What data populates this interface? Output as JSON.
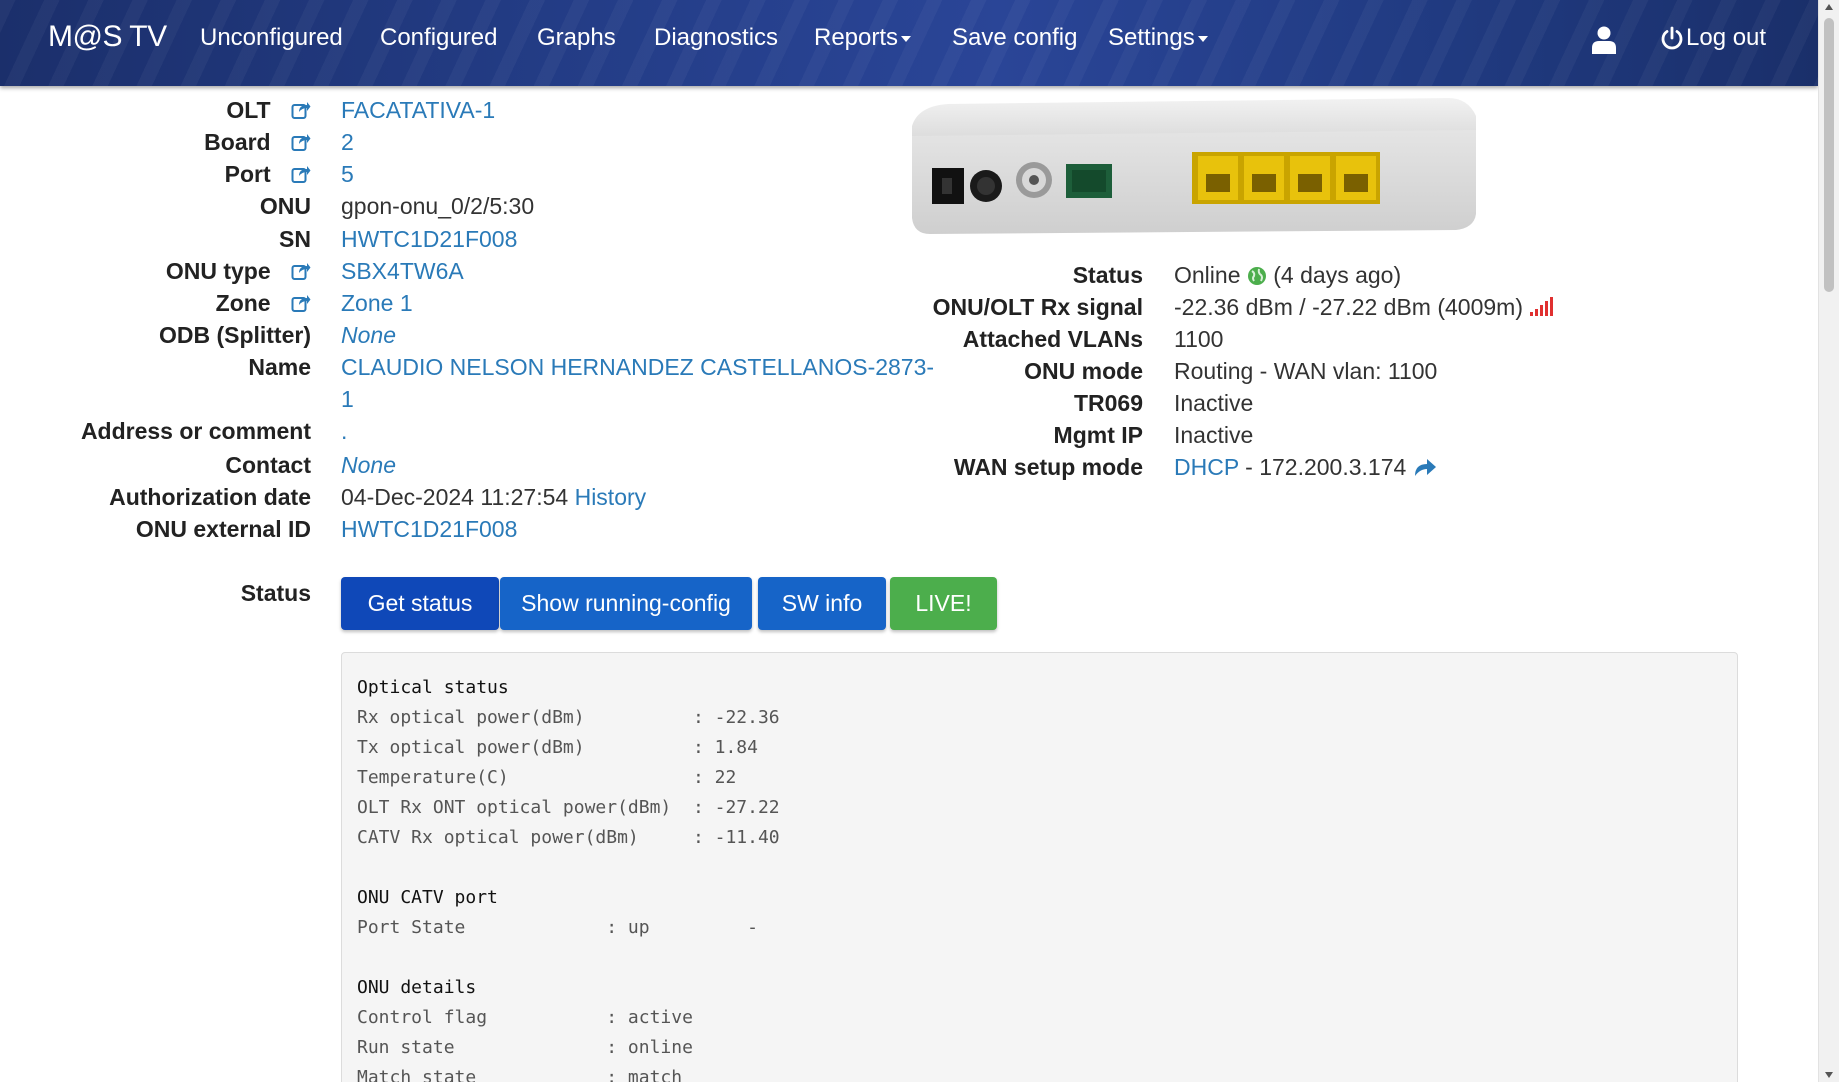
{
  "navbar": {
    "brand": "M@S TV",
    "items": [
      {
        "label": "Unconfigured"
      },
      {
        "label": "Configured"
      },
      {
        "label": "Graphs"
      },
      {
        "label": "Diagnostics"
      },
      {
        "label": "Reports"
      },
      {
        "label": "Save config"
      },
      {
        "label": "Settings"
      }
    ],
    "user_icon": "user-icon",
    "logout_label": "Log out"
  },
  "onu_details": {
    "olt": {
      "label": "OLT",
      "value": "FACATATIVA-1"
    },
    "board": {
      "label": "Board",
      "value": "2"
    },
    "port": {
      "label": "Port",
      "value": "5"
    },
    "onu": {
      "label": "ONU",
      "value": "gpon-onu_0/2/5:30"
    },
    "sn": {
      "label": "SN",
      "value": "HWTC1D21F008"
    },
    "onu_type": {
      "label": "ONU type",
      "value": "SBX4TW6A"
    },
    "zone": {
      "label": "Zone",
      "value": "Zone 1"
    },
    "odb": {
      "label": "ODB (Splitter)",
      "value": "None"
    },
    "name": {
      "label": "Name",
      "value_line1": "CLAUDIO NELSON HERNANDEZ CASTELLANOS-2873-",
      "value_line2": "1"
    },
    "address": {
      "label": "Address or comment",
      "value": "."
    },
    "contact": {
      "label": "Contact",
      "value": "None"
    },
    "auth_date": {
      "label": "Authorization date",
      "value": "04-Dec-2024 11:27:54",
      "link": "History"
    },
    "external_id": {
      "label": "ONU external ID",
      "value": "HWTC1D21F008"
    },
    "status_label": "Status"
  },
  "status_panel": {
    "status": {
      "label": "Status",
      "value": "Online",
      "suffix": "(4 days ago)"
    },
    "rx_signal": {
      "label": "ONU/OLT Rx signal",
      "value": "-22.36 dBm / -27.22 dBm (4009m)"
    },
    "vlans": {
      "label": "Attached VLANs",
      "value": "1100"
    },
    "onu_mode": {
      "label": "ONU mode",
      "value": "Routing - WAN vlan: 1100"
    },
    "tr069": {
      "label": "TR069",
      "value": "Inactive"
    },
    "mgmt_ip": {
      "label": "Mgmt IP",
      "value": "Inactive"
    },
    "wan_setup": {
      "label": "WAN setup mode",
      "link": "DHCP",
      "value": " - 172.200.3.174"
    }
  },
  "buttons": {
    "get_status": "Get status",
    "running_config": "Show running-config",
    "sw_info": "SW info",
    "live": "LIVE!"
  },
  "output_lines": [
    "Optical status",
    "Rx optical power(dBm)          : -22.36",
    "Tx optical power(dBm)          : 1.84",
    "Temperature(C)                 : 22",
    "OLT Rx ONT optical power(dBm)  : -27.22",
    "CATV Rx optical power(dBm)     : -11.40",
    "",
    "ONU CATV port",
    "Port State             : up         -",
    "",
    "ONU details",
    "Control flag           : active",
    "Run state              : online",
    "Match state            : match"
  ],
  "colors": {
    "navbar": "#233c85",
    "link": "#2a7ab8",
    "btn_primary": "#0f48b8",
    "btn_blue": "#1664c8",
    "btn_green": "#4cae4c",
    "online": "#4cae4c",
    "signal": "#e03030"
  }
}
